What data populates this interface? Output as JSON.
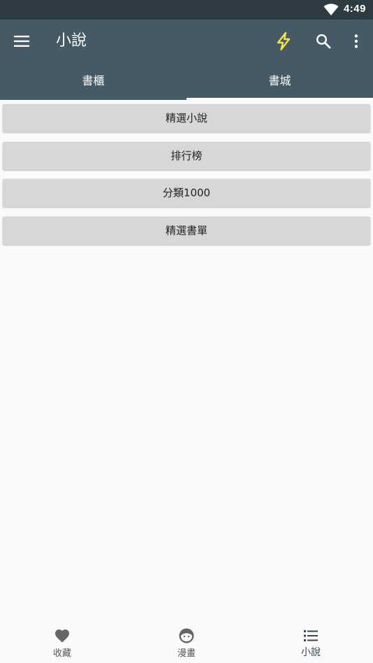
{
  "status_bar": {
    "time": "4:49"
  },
  "app_bar": {
    "title": "小說",
    "icons": [
      "menu-icon",
      "lightning-bolt-icon",
      "search-icon",
      "more-vert-icon"
    ],
    "bolt_color": "#f2e34a"
  },
  "tabs": [
    {
      "label": "書櫃",
      "active": false
    },
    {
      "label": "書城",
      "active": true
    }
  ],
  "menu_buttons": [
    {
      "label": "精選小說"
    },
    {
      "label": "排行榜"
    },
    {
      "label": "分類1000"
    },
    {
      "label": "精選書單"
    }
  ],
  "bottom_nav": [
    {
      "label": "收藏",
      "icon": "heart-icon",
      "active": false
    },
    {
      "label": "漫畫",
      "icon": "face-icon",
      "active": false
    },
    {
      "label": "小說",
      "icon": "list-icon",
      "active": true
    }
  ],
  "colors": {
    "status_bar": "#2e3b42",
    "app_bar": "#455a64",
    "button_bg": "#d6d7d7",
    "background": "#fafafa"
  }
}
